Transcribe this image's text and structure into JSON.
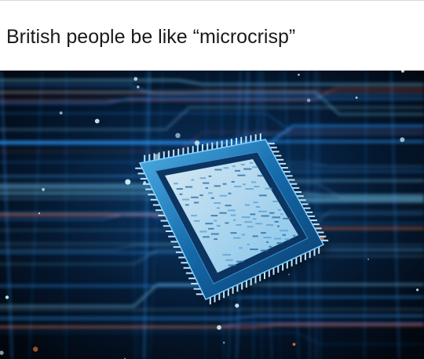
{
  "caption": {
    "text": "British people be like “microcrisp”"
  },
  "image": {
    "subject": "microchip-on-circuit-board",
    "colors": {
      "background": "#02060d",
      "glow_blue": "#2f9bff",
      "glow_cyan": "#7fd8ff",
      "chip_body": "#0f4f86",
      "chip_rim": "#5fb4e8",
      "die": "#c9ecff",
      "accent_orange": "#ff7a3a"
    }
  }
}
